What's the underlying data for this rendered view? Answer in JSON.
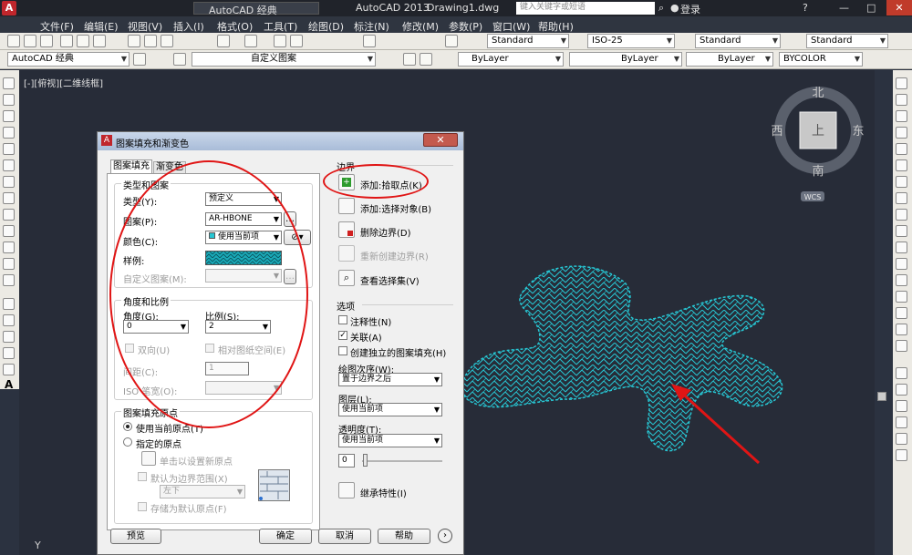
{
  "titlebar": {
    "workspace": "AutoCAD 经典",
    "app_title": "AutoCAD 2013",
    "document": "Drawing1.dwg",
    "search_placeholder": "键入关键字或短语",
    "login": "登录"
  },
  "menubar": [
    "文件(F)",
    "编辑(E)",
    "视图(V)",
    "插入(I)",
    "格式(O)",
    "工具(T)",
    "绘图(D)",
    "标注(N)",
    "修改(M)",
    "参数(P)",
    "窗口(W)",
    "帮助(H)"
  ],
  "toolbar1": {
    "text_style": "Standard",
    "dim_style": "ISO-25",
    "table_style": "Standard",
    "mleader_style": "Standard"
  },
  "toolbar2": {
    "workspace": "AutoCAD 经典",
    "ucs_name": "自定义图案",
    "layer_color": "ByLayer",
    "linetype": "ByLayer",
    "lineweight": "ByLayer",
    "plotstyle": "BYCOLOR"
  },
  "viewport": {
    "label": "[-][俯视][二维线框]",
    "compass": {
      "north": "北",
      "south": "南",
      "east": "东",
      "west": "西",
      "top": "上",
      "wcs": "WCS"
    },
    "ucs_y": "Y"
  },
  "dialog": {
    "title": "图案填充和渐变色",
    "close": "✕",
    "tabs": [
      "图案填充",
      "渐变色"
    ],
    "type_pattern": {
      "group": "类型和图案",
      "type_label": "类型(Y):",
      "type_value": "预定义",
      "pattern_label": "图案(P):",
      "pattern_value": "AR-HBONE",
      "color_label": "颜色(C):",
      "color_value": "使用当前项",
      "swatch_label": "样例:",
      "custom_label": "自定义图案(M):"
    },
    "angle_scale": {
      "group": "角度和比例",
      "angle_label": "角度(G):",
      "angle_value": "0",
      "scale_label": "比例(S):",
      "scale_value": "2",
      "double_label": "双向(U)",
      "relative_label": "相对图纸空间(E)",
      "spacing_label": "间距(C):",
      "spacing_value": "1",
      "iso_label": "ISO 笔宽(O):"
    },
    "origin": {
      "group": "图案填充原点",
      "current_label": "使用当前原点(T)",
      "specified_label": "指定的原点",
      "click_label": "单击以设置新原点",
      "default_boundary_label": "默认为边界范围(X)",
      "position_value": "左下",
      "store_label": "存储为默认原点(F)"
    },
    "boundary": {
      "group": "边界",
      "add_pick": "添加:拾取点(K)",
      "add_select": "添加:选择对象(B)",
      "remove": "删除边界(D)",
      "recreate": "重新创建边界(R)",
      "view_selection": "查看选择集(V)"
    },
    "options": {
      "group": "选项",
      "annotative": "注释性(N)",
      "associative": "关联(A)",
      "separate": "创建独立的图案填充(H)",
      "draw_order_label": "绘图次序(W):",
      "draw_order_value": "置于边界之后",
      "layer_label": "图层(L):",
      "layer_value": "使用当前项",
      "transparency_label": "透明度(T):",
      "transparency_value": "使用当前项",
      "transparency_num": "0"
    },
    "inherit": "继承特性(I)",
    "buttons": {
      "preview": "预览",
      "ok": "确定",
      "cancel": "取消",
      "help": "帮助"
    }
  },
  "colors": {
    "viewport_bg": "#272c38",
    "hatch": "#27c6d3",
    "annotation_red": "#e01515"
  }
}
